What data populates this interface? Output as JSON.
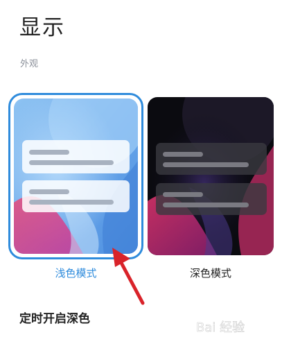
{
  "page": {
    "title": "显示",
    "appearance_section_label": "外观"
  },
  "appearance": {
    "modes": [
      {
        "label": "浅色模式",
        "selected": true
      },
      {
        "label": "深色模式",
        "selected": false
      }
    ]
  },
  "settings": {
    "scheduled_dark_label": "定时开启深色"
  },
  "colors": {
    "accent": "#2e8bdc",
    "annotation_arrow": "#d9232a",
    "text_primary": "#222222",
    "text_secondary": "#8a8f99"
  },
  "watermark": {
    "text": "Bai 经验"
  }
}
